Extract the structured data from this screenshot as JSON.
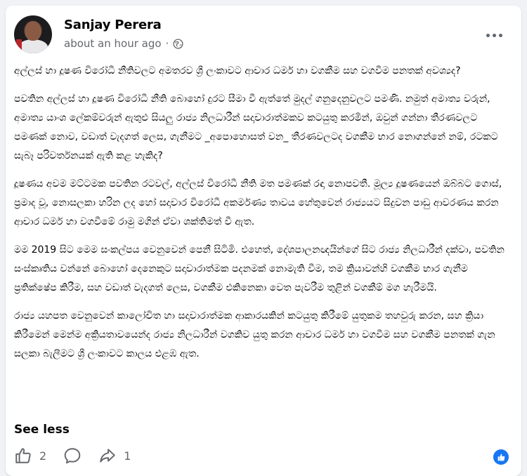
{
  "post": {
    "author": "Sanjay Perera",
    "time": "about an hour ago",
    "separator": "·",
    "paragraphs": [
      "අල්ලස් හා දූෂණ විරෝධී නීතිවලට අමතරව ශ්‍රී ලංකාවට ආචාර ධර්ම හා වගකීම සහ වගවීම පනතක් අවශ්‍යද?",
      "පවතින අල්ලස් හා දූෂණ විරෝධී නීති බොහෝ දුරට සීමා වී ඇත්තේ මුදල් ගනුදෙනුවලට පමණි. නමුත් අමාත්‍ය වරුන්, අමාත්‍ය යාංශ ලේකම්වරුන් ඇතුළු සියලු රාජ්‍ය නිලධාරීන් සදාචාරාත්මකව කටයුතු කරමින්, ඔවුන් ගන්නා තීරණවලට පමණක් නොව, වඩාත් වැදගත් ලෙස, ගැනීමට _අපොහොසත් වන_ තීරණවලටද වගකීම භාර නොගන්නේ නම්, රටකට සැබෑ පරිවර්තනයක් ඇති කළ හැකිද?",
      "දූෂණය අවම මට්ටමක පවතින රටවල්, අල්ලස් විරෝධී නීති මත පමණක් රඳා නොපවතී. මූල්‍ය දූෂණයෙන් ඔබ්බට ගොස්, ප්‍රමාද වූ, නොසලකා හරින ලද හෝ සදාචාර විරෝධී අකර්මණ්‍ය තාවය හේතුවෙන් රාජ්‍යයට සිදුවන පාඩු ආවරණය කරන ආචාර ධර්ම හා වගවීමේ රාමු මගින් ඒවා ශක්තිමත් වී ඇත.",
      "මම 2019 සිට මෙම සංකල්පය වෙනුවෙන් පෙනී සිටිමි. එහෙත්, දේශපාලනඥයින්ගේ සිට රාජ්‍ය නිලධාරීන් දක්වා, පවතින සංස්කෘතිය වන්නේ බොහෝ දෙනෙකුට සදාචාරාත්මක පදනමක් නොමැති වීම, තම ක්‍රියාවන්හි වගකීම භාර ගැනීම ප්‍රතික්ෂේප කිරීම, සහ වඩාත් වැදගත් ලෙස, වගකීම එකිනෙකා වෙත පැවරීම තුළින් වගකීම් මග හැරීමයි.",
      "රාජ්‍ය යහපත වෙනුවෙන් කාලෝචිත හා සදාචාරාත්මක ආකාරයකින් කටයුතු කිරීමේ යුතුකම තහවුරු කරන, සහ ක්‍රියා කිරීමෙන් මෙන්ම අක්‍රියතාවයෙන්ද රාජ්‍ය නිලධාරීන් වගකිව යුතු කරන ආචාර ධර්ම හා වගවීම සහ වගකීම පනතක් ගැන සලකා බැලීමට ශ්‍රී ලංකාවට කාලය එළඹ ඇත."
    ],
    "see_less": "See less"
  },
  "actions": {
    "like_count": "2",
    "share_count": "1"
  },
  "colors": {
    "accent": "#1877f2",
    "muted": "#65676b",
    "text": "#050505"
  },
  "icons": [
    "globe-icon",
    "more-icon",
    "like-icon",
    "comment-icon",
    "share-icon",
    "like-reaction-icon"
  ]
}
